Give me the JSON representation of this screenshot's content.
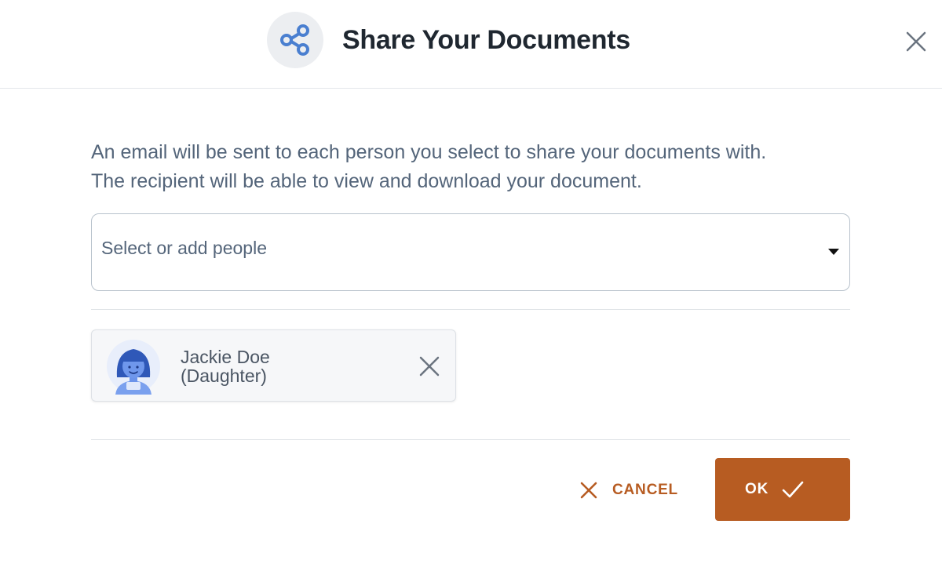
{
  "dialog": {
    "title": "Share Your Documents",
    "title_icon": "share-icon",
    "close_icon": "close-icon"
  },
  "description": {
    "line1": "An email will be sent to each person you select to share your documents with.",
    "line2": "The recipient will be able to view and download your document."
  },
  "people_select": {
    "placeholder": "Select or add people",
    "caret_icon": "caret-down-icon"
  },
  "selected_people": [
    {
      "name": "Jackie Doe",
      "relation": "(Daughter)",
      "avatar_icon": "avatar-girl-icon",
      "remove_icon": "close-icon"
    }
  ],
  "actions": {
    "cancel_label": "CANCEL",
    "cancel_icon": "close-icon",
    "ok_label": "OK",
    "ok_icon": "check-icon"
  },
  "colors": {
    "accent": "#b75c22",
    "share_icon": "#4a7fd0",
    "avatar": "#5a86e6"
  }
}
